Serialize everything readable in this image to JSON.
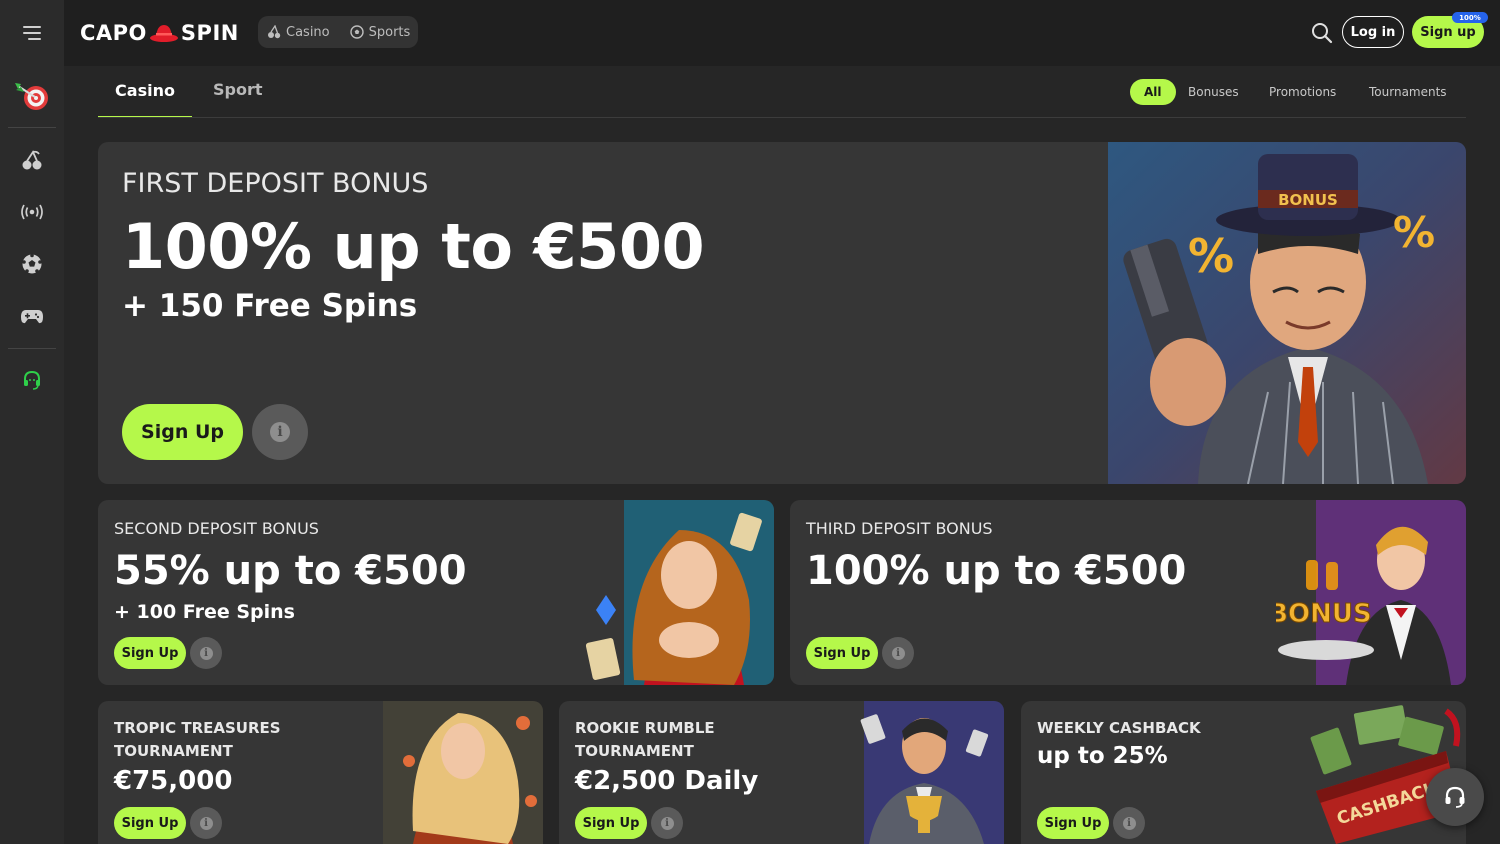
{
  "header": {
    "logo_left": "CAPO",
    "logo_right": "SPIN",
    "modes": [
      {
        "label": "Casino",
        "icon": "cherry-icon"
      },
      {
        "label": "Sports",
        "icon": "soccer-ball-icon"
      }
    ],
    "login_label": "Log in",
    "signup_label": "Sign up",
    "signup_badge": "100%"
  },
  "sidebar": {
    "items": [
      "dart-target-icon",
      "cherry-icon",
      "live-broadcast-icon",
      "soccer-ball-icon",
      "gamepad-icon",
      "headset-icon"
    ]
  },
  "tabs": {
    "casino": "Casino",
    "sport": "Sport"
  },
  "filters": {
    "all": "All",
    "bonuses": "Bonuses",
    "promotions": "Promotions",
    "tournaments": "Tournaments"
  },
  "hero": {
    "kicker": "FIRST DEPOSIT BONUS",
    "headline": "100% up to €500",
    "subline": "+ 150 Free Spins",
    "cta": "Sign Up",
    "art_word": "BONUS",
    "art_pct": "%"
  },
  "card2": {
    "kicker": "SECOND DEPOSIT BONUS",
    "headline": "55% up to €500",
    "subline": "+ 100 Free Spins",
    "cta": "Sign Up"
  },
  "card3": {
    "kicker": "THIRD DEPOSIT BONUS",
    "headline": "100% up to €500",
    "cta": "Sign Up",
    "art_word": "BONUS"
  },
  "card4": {
    "kicker_1": "TROPIC TREASURES",
    "kicker_2": "TOURNAMENT",
    "headline": "€75,000",
    "cta": "Sign Up"
  },
  "card5": {
    "kicker_1": "ROOKIE RUMBLE",
    "kicker_2": "TOURNAMENT",
    "headline": "€2,500 Daily",
    "cta": "Sign Up"
  },
  "card6": {
    "kicker": "WEEKLY CASHBACK",
    "headline": "up to 25%",
    "cta": "Sign Up",
    "art_word": "CASHBACK"
  },
  "colors": {
    "accent": "#b5f84a",
    "background": "#262626",
    "card": "#363636"
  }
}
